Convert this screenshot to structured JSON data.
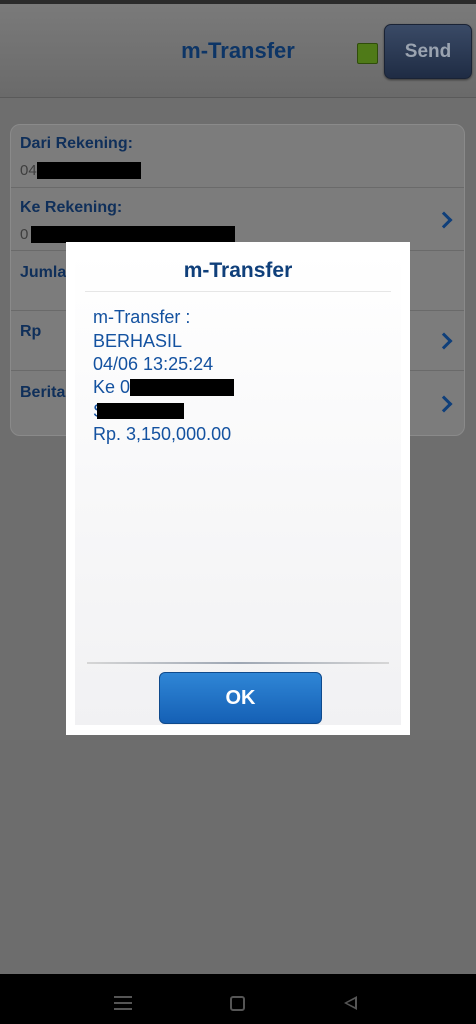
{
  "header": {
    "title": "m-Transfer",
    "send_label": "Send",
    "indicator_color": "#4f7a18"
  },
  "form": {
    "from_label": "Dari Rekening:",
    "from_value_prefix": "04",
    "to_label": "Ke Rekening:",
    "to_value_prefix": "0",
    "amount_label": "Jumla",
    "currency_label": "Rp",
    "message_label": "Berita"
  },
  "dialog": {
    "title": "m-Transfer",
    "lines": [
      "m-Transfer :",
      "BERHASIL",
      "04/06 13:25:24",
      "Ke 0",
      "S",
      "Rp. 3,150,000.00"
    ],
    "ok_label": "OK"
  },
  "nav": {
    "icons": [
      "menu-icon",
      "home-icon",
      "back-icon"
    ]
  }
}
